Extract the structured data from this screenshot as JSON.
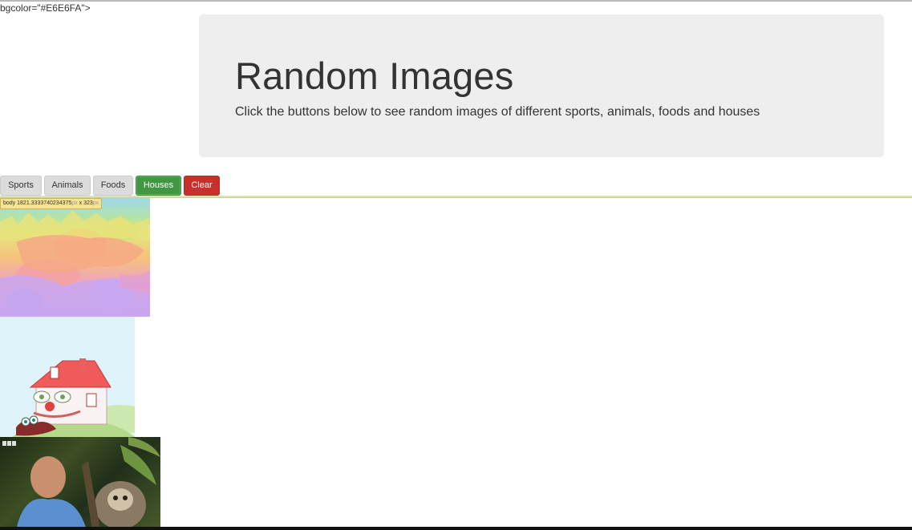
{
  "stray_text": "bgcolor=\"#E6E6FA\">",
  "jumbotron": {
    "title": "Random Images",
    "subtitle": "Click the buttons below to see random images of different sports, animals, foods and houses"
  },
  "buttons": {
    "sports": "Sports",
    "animals": "Animals",
    "foods": "Foods",
    "houses": "Houses",
    "clear": "Clear"
  },
  "tooltip": {
    "tag": "body",
    "width": "1821.3333740234375",
    "px1": "px",
    "x": " x ",
    "height": "323",
    "px2": "px"
  },
  "colors": {
    "jumbotron_bg": "#eeeeee",
    "houses_button": "#419641",
    "clear_button": "#c9302c",
    "default_button": "#dcdcdc"
  },
  "images": [
    {
      "name": "abstract-gif"
    },
    {
      "name": "cartoon-house-gif"
    },
    {
      "name": "jungle-presenter-gif"
    }
  ]
}
